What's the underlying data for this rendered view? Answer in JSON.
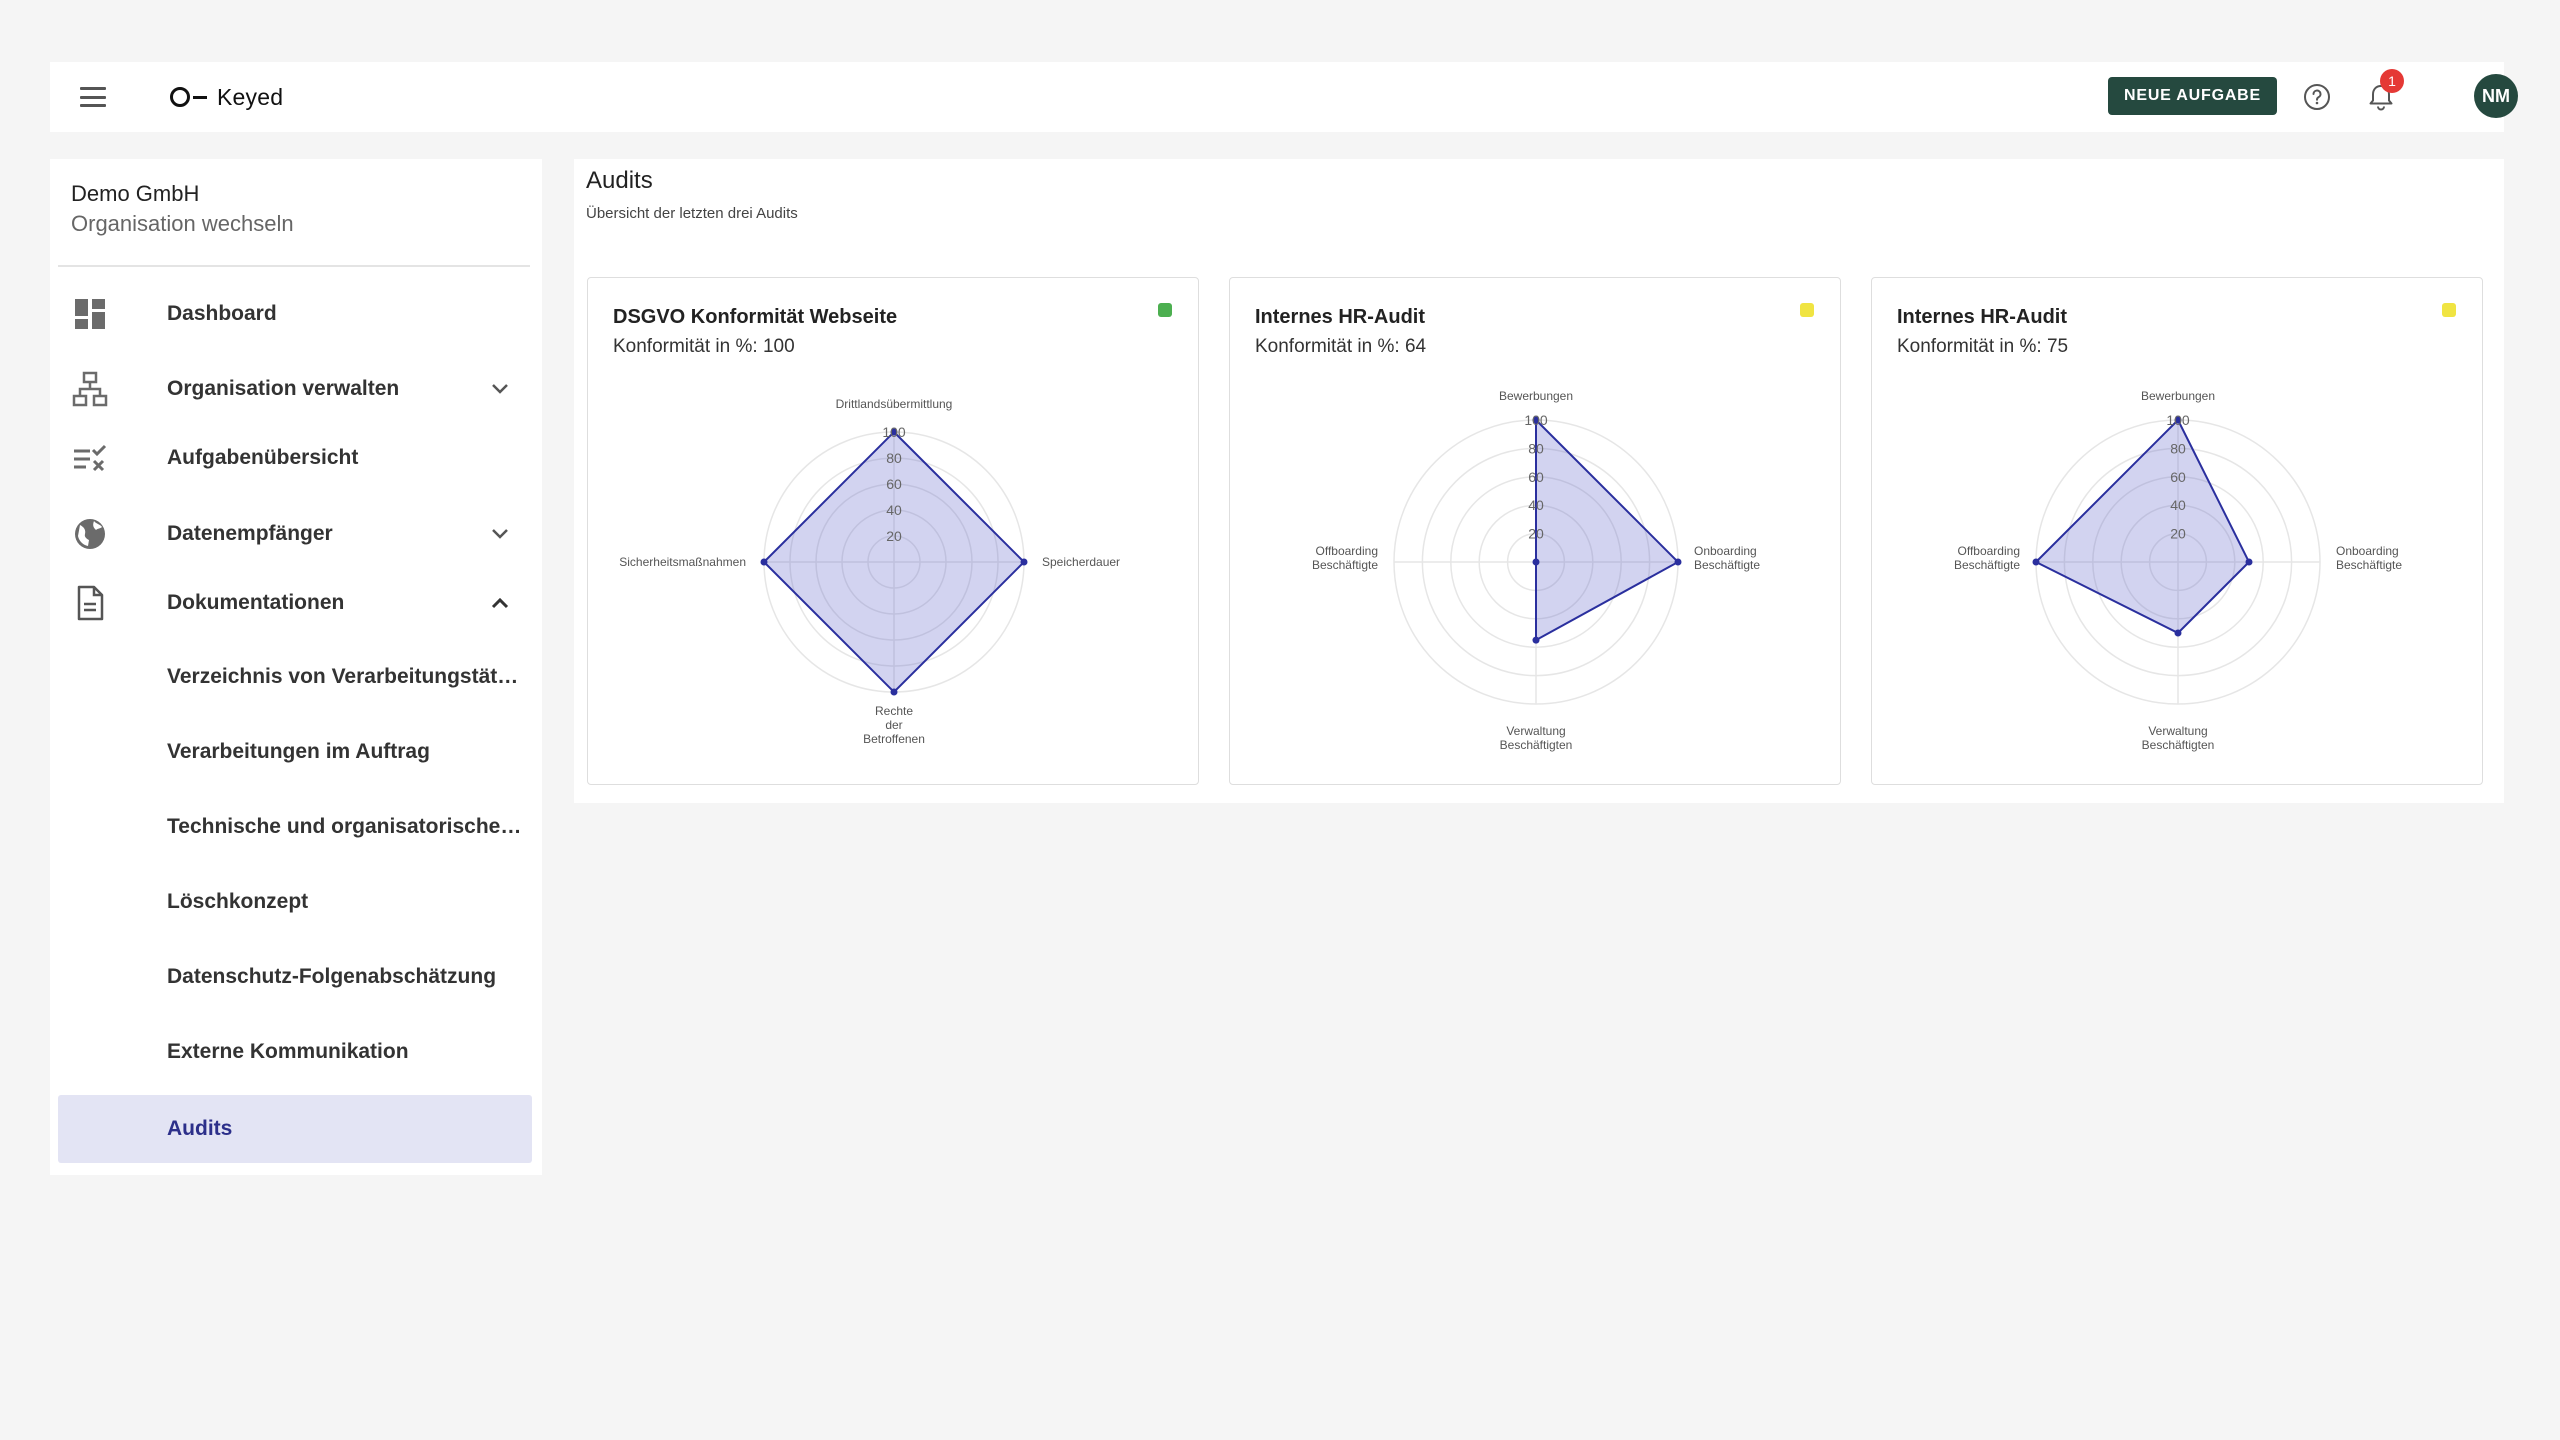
{
  "header": {
    "logo_text": "Keyed",
    "new_task_label": "NEUE AUFGABE",
    "notification_count": "1",
    "avatar_initials": "NM"
  },
  "sidebar": {
    "org_name": "Demo GmbH",
    "org_switch": "Organisation wechseln",
    "items": [
      {
        "label": "Dashboard",
        "icon": "dashboard-icon"
      },
      {
        "label": "Organisation verwalten",
        "icon": "org-structure-icon",
        "expand": "chevron-down-icon"
      },
      {
        "label": "Aufgabenübersicht",
        "icon": "task-list-icon"
      },
      {
        "label": "Datenempfänger",
        "icon": "globe-icon",
        "expand": "chevron-down-icon"
      },
      {
        "label": "Dokumentationen",
        "icon": "document-icon",
        "expand": "chevron-up-icon"
      }
    ],
    "sub_items": [
      "Verzeichnis von Verarbeitungstätigkeiten",
      "Verarbeitungen im Auftrag",
      "Technische und organisatorische Maßnahmen",
      "Löschkonzept",
      "Datenschutz-Folgenabschätzung",
      "Externe Kommunikation",
      "Audits"
    ],
    "active_sub_item": "Audits"
  },
  "main": {
    "title": "Audits",
    "subtitle": "Übersicht der letzten drei Audits"
  },
  "chart_data": [
    {
      "type": "radar",
      "title": "DSGVO Konformität Webseite",
      "conformity_label": "Konformität in %: 100",
      "status_color": "#4caf50",
      "axes": [
        "Drittlandsübermittlung",
        "Speicherdauer",
        "Rechte der Betroffenen",
        "Sicherheitsmaßnahmen"
      ],
      "values": [
        100,
        100,
        100,
        100
      ],
      "ticks": [
        20,
        40,
        60,
        80,
        100
      ],
      "rmax": 100,
      "fill": "rgba(92,96,200,0.28)",
      "stroke": "#2a2f9e"
    },
    {
      "type": "radar",
      "title": "Internes HR-Audit",
      "conformity_label": "Konformität in %: 64",
      "status_color": "#f0e442",
      "axes": [
        "Bewerbungen",
        "Onboarding Beschäftigte",
        "Verwaltung Beschäftigten",
        "Offboarding Beschäftigte"
      ],
      "values": [
        100,
        100,
        55,
        0
      ],
      "ticks": [
        20,
        40,
        60,
        80,
        100
      ],
      "rmax": 100,
      "fill": "rgba(92,96,200,0.28)",
      "stroke": "#2a2f9e"
    },
    {
      "type": "radar",
      "title": "Internes HR-Audit",
      "conformity_label": "Konformität in %: 75",
      "status_color": "#f0e442",
      "axes": [
        "Bewerbungen",
        "Onboarding Beschäftigte",
        "Verwaltung Beschäftigten",
        "Offboarding Beschäftigte"
      ],
      "values": [
        100,
        50,
        50,
        100
      ],
      "ticks": [
        20,
        40,
        60,
        80,
        100
      ],
      "rmax": 100,
      "fill": "rgba(92,96,200,0.28)",
      "stroke": "#2a2f9e"
    }
  ]
}
